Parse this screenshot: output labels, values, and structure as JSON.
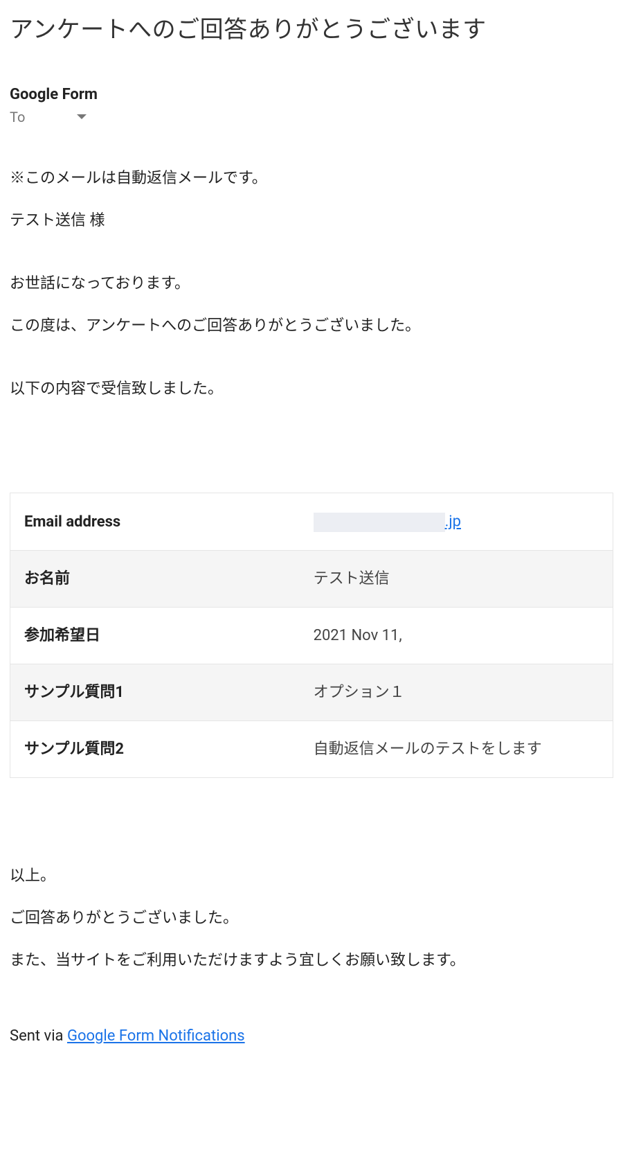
{
  "subject": "アンケートへのご回答ありがとうございます",
  "sender": "Google Form",
  "to_label": "To",
  "body": {
    "auto_reply_note": "※このメールは自動返信メールです。",
    "salutation": "テスト送信 様",
    "greeting": "お世話になっております。",
    "thanks_line": "この度は、アンケートへのご回答ありがとうございました。",
    "received_line": "以下の内容で受信致しました。",
    "closing1": "以上。",
    "closing2": "ご回答ありがとうございました。",
    "closing3": "また、当サイトをご利用いただけますよう宜しくお願い致します。"
  },
  "table": {
    "rows": [
      {
        "label": "Email address",
        "value_suffix": ".jp",
        "is_email": true
      },
      {
        "label": "お名前",
        "value": "テスト送信"
      },
      {
        "label": "参加希望日",
        "value": "2021 Nov 11,"
      },
      {
        "label": "サンプル質問1",
        "value": "オプション１"
      },
      {
        "label": "サンプル質問2",
        "value": "自動返信メールのテストをします"
      }
    ]
  },
  "footer": {
    "sent_via_prefix": "Sent via ",
    "link_text": "Google Form Notifications"
  }
}
